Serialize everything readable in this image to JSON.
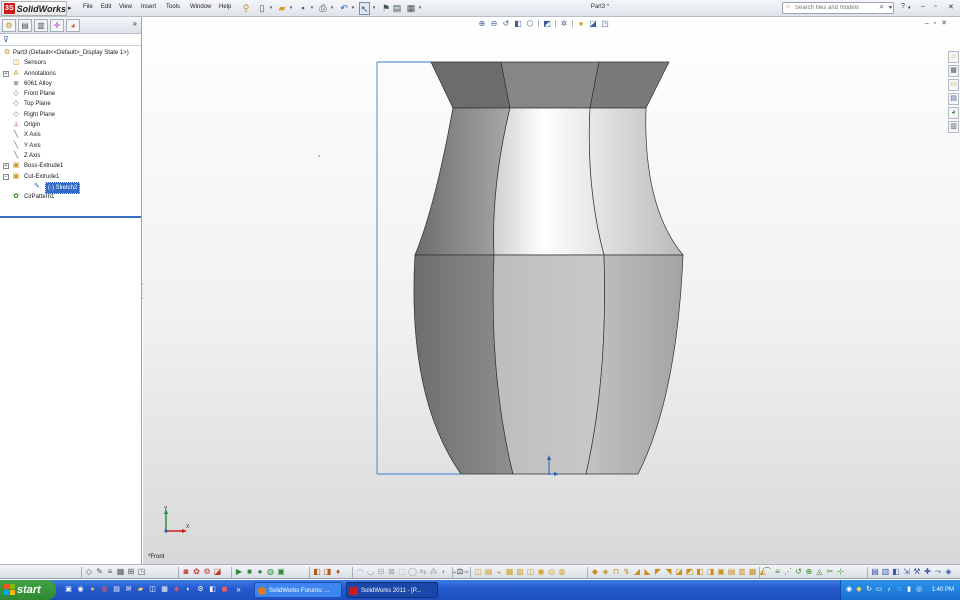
{
  "app": {
    "logo_mark": "3S",
    "logo_text": "SolidWorks",
    "doc_title": "Part3 *"
  },
  "menu": [
    "File",
    "Edit",
    "View",
    "Insert",
    "Tools",
    "Window",
    "Help"
  ],
  "search": {
    "placeholder": "Search files and models"
  },
  "window_controls": {
    "help": "?",
    "minimize": "–",
    "restore": "▫",
    "close": "✕"
  },
  "feature_tree": {
    "root": "Part3  (Default<<Default>_Display State 1>)",
    "items": [
      {
        "label": "Sensors",
        "icon": "sensor-icon",
        "glyph": "◫",
        "color": "#c98f1c",
        "expand": ""
      },
      {
        "label": "Annotations",
        "icon": "annotations-icon",
        "glyph": "A",
        "color": "#c98f1c",
        "expand": "+"
      },
      {
        "label": "6061 Alloy",
        "icon": "material-icon",
        "glyph": "≣",
        "color": "#555555",
        "expand": ""
      },
      {
        "label": "Front Plane",
        "icon": "plane-icon",
        "glyph": "◇",
        "color": "#666666",
        "expand": ""
      },
      {
        "label": "Top Plane",
        "icon": "plane-icon",
        "glyph": "◇",
        "color": "#666666",
        "expand": ""
      },
      {
        "label": "Right Plane",
        "icon": "plane-icon",
        "glyph": "◇",
        "color": "#666666",
        "expand": ""
      },
      {
        "label": "Origin",
        "icon": "origin-icon",
        "glyph": "⊥",
        "color": "#b51f1f",
        "expand": ""
      },
      {
        "label": "X Axis",
        "icon": "axis-icon",
        "glyph": "╲",
        "color": "#555555",
        "expand": ""
      },
      {
        "label": "Y Axis",
        "icon": "axis-icon",
        "glyph": "╲",
        "color": "#555555",
        "expand": ""
      },
      {
        "label": "Z Axis",
        "icon": "axis-icon",
        "glyph": "╲",
        "color": "#555555",
        "expand": ""
      },
      {
        "label": "Boss-Extrude1",
        "icon": "boss-extrude-icon",
        "glyph": "▣",
        "color": "#c98f1c",
        "expand": "+"
      },
      {
        "label": "Cut-Extrude1",
        "icon": "cut-extrude-icon",
        "glyph": "▣",
        "color": "#c98f1c",
        "expand": "−"
      },
      {
        "label": "(-) Sketch2",
        "icon": "sketch-icon",
        "glyph": "✎",
        "color": "#2a6ab8",
        "expand": "",
        "selected": true,
        "indent": true
      },
      {
        "label": "CirPattern1",
        "icon": "circular-pattern-icon",
        "glyph": "✿",
        "color": "#3b8a2a",
        "expand": ""
      }
    ]
  },
  "viewport": {
    "orientation_label": "*Front",
    "triad_y": "Y",
    "triad_x": "X"
  },
  "taskbar": {
    "start": "start",
    "tasks": [
      {
        "label": "SolidWorks Forums: ...",
        "icon": "browser-icon"
      },
      {
        "label": "SolidWorks 2011 - [P...",
        "icon": "solidworks-icon"
      }
    ],
    "clock": "1:40 PM"
  },
  "colors": {
    "accent": "#3169c6",
    "sketch_line": "#3a7bd5",
    "taskbar": "#245edc",
    "start": "#3a9a3d"
  }
}
